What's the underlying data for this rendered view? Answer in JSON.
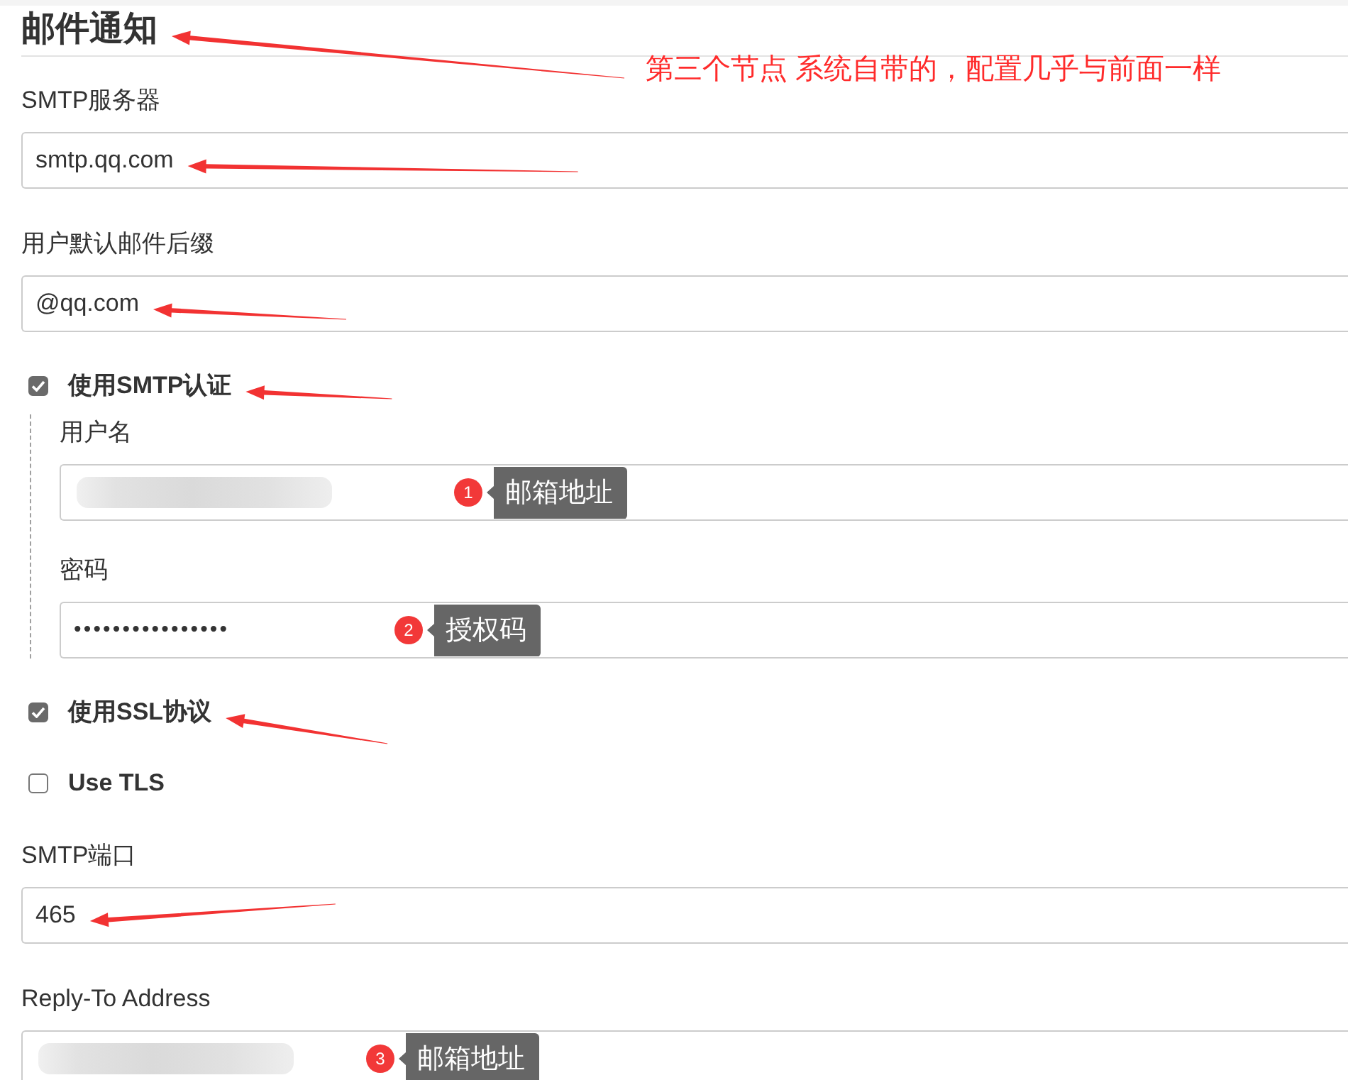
{
  "section": {
    "title": "邮件通知",
    "note": "第三个节点 系统自带的，配置几乎与前面一样",
    "arrow": true
  },
  "items": [
    {
      "kind": "field",
      "label": "SMTP服务器",
      "value": "smtp.qq.com",
      "arrow": true
    },
    {
      "kind": "field",
      "label": "用户默认邮件后缀",
      "value": "@qq.com",
      "arrow": true
    },
    {
      "kind": "checkbox",
      "label": "使用SMTP认证",
      "checked": true,
      "arrow": true,
      "children": [
        {
          "kind": "field",
          "label": "用户名",
          "redacted": true,
          "arrow": false,
          "annotation": {
            "number": "1",
            "text": "邮箱地址"
          }
        },
        {
          "kind": "password",
          "label": "密码",
          "value": "••••••••••••••••",
          "arrow": false,
          "annotation": {
            "number": "2",
            "text": "授权码"
          }
        }
      ]
    },
    {
      "kind": "checkbox",
      "label": "使用SSL协议",
      "checked": true,
      "arrow": true
    },
    {
      "kind": "checkbox",
      "label": "Use TLS",
      "checked": false,
      "arrow": false
    },
    {
      "kind": "field",
      "label": "SMTP端口",
      "value": "465",
      "arrow": true
    },
    {
      "kind": "field",
      "label": "Reply-To Address",
      "redacted": true,
      "arrow": false,
      "annotation": {
        "number": "3",
        "text": "邮箱地址"
      }
    }
  ]
}
